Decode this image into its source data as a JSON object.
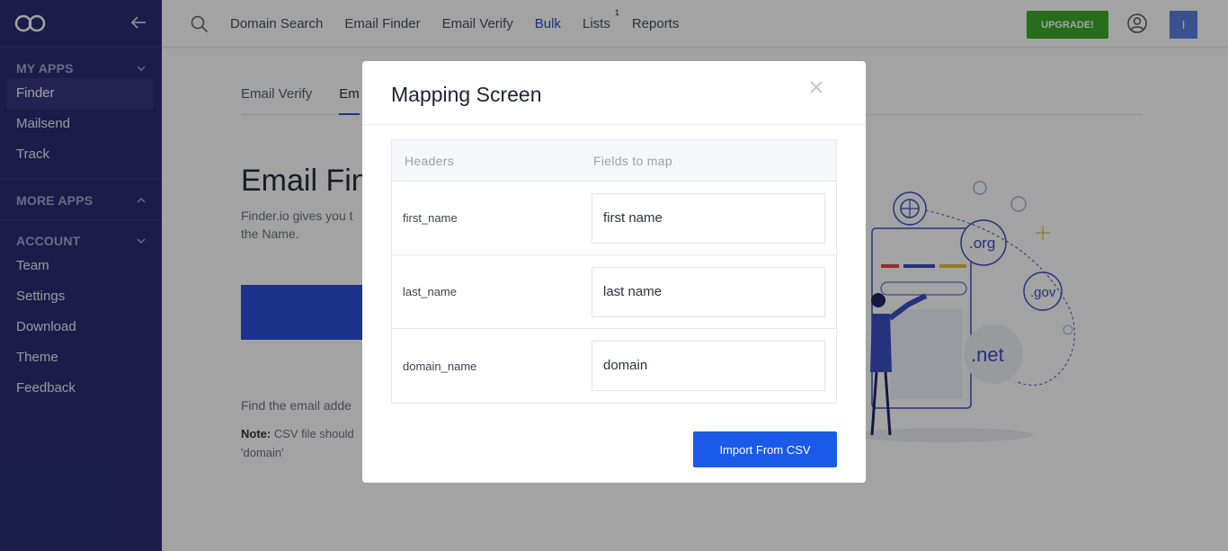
{
  "sidebar": {
    "my_apps": "MY APPS",
    "my_apps_items": [
      "Finder",
      "Mailsend",
      "Track"
    ],
    "more_apps": "MORE APPS",
    "account": "ACCOUNT",
    "account_items": [
      "Team",
      "Settings",
      "Download",
      "Theme",
      "Feedback"
    ]
  },
  "topnav": {
    "items": [
      "Domain Search",
      "Email Finder",
      "Email Verify",
      "Bulk",
      "Lists",
      "Reports"
    ],
    "active": "Bulk",
    "lists_badge": "1",
    "upgrade": "UPGRADE!",
    "avatar_initial": "I"
  },
  "main": {
    "tabs": [
      "Email Verify",
      "Em"
    ],
    "heading": "Email Fin",
    "desc": "Finder.io gives you t the Name.",
    "find_text": "Find the email adde",
    "note_label": "Note:",
    "note_text": " CSV file should 'domain'"
  },
  "illustration": {
    "labels": [
      ".org",
      ".gov",
      ".net"
    ]
  },
  "modal": {
    "title": "Mapping Screen",
    "col_headers": "Headers",
    "col_fields": "Fields to map",
    "rows": [
      {
        "header": "first_name",
        "field": "first name"
      },
      {
        "header": "last_name",
        "field": "last name"
      },
      {
        "header": "domain_name",
        "field": "domain"
      }
    ],
    "import_button": "Import From CSV"
  },
  "colors": {
    "sidebar": "#2b2d72",
    "accent": "#2b4fd8",
    "upgrade": "#3dab2b",
    "import": "#1b5ae8"
  }
}
